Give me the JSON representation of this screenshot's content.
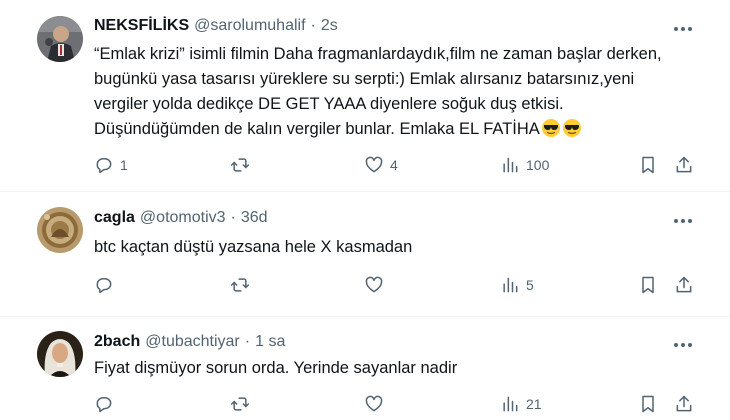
{
  "tweets": [
    {
      "name": "NEKSFİLİKS",
      "handle": "@sarolumuhalif",
      "time": "2s",
      "text": "“Emlak krizi” isimli filmin Daha fragmanlardaydık,film ne zaman başlar derken, bugünkü yasa tasarısı yüreklere su serpti:) Emlak alırsanız batarsınız,yeni vergiler yolda dedikçe DE GET YAAA diyenlere soğuk duş etkisi. Düşündüğümden de kalın vergiler bunlar. Emlaka EL FATİHA",
      "emoji": [
        "sunglasses-emoji",
        "sunglasses-emoji"
      ],
      "replies": "1",
      "retweets": "",
      "likes": "4",
      "views": "100"
    },
    {
      "name": "cagla",
      "handle": "@otomotiv3",
      "time": "36d",
      "text": "btc kaçtan düştü yazsana hele X kasmadan",
      "replies": "",
      "retweets": "",
      "likes": "",
      "views": "5"
    },
    {
      "name": "2bach",
      "handle": "@tubachtiyar",
      "time": "1 sa",
      "text": "Fiyat dişmüyor sorun orda. Yerinde sayanlar nadir",
      "replies": "",
      "retweets": "",
      "likes": "",
      "views": "21"
    }
  ],
  "colors": {
    "text_primary": "#0f1419",
    "text_secondary": "#536471",
    "divider": "#eff3f4"
  },
  "icons": [
    "reply-icon",
    "retweet-icon",
    "like-icon",
    "views-icon",
    "bookmark-icon",
    "share-icon",
    "more-icon"
  ]
}
